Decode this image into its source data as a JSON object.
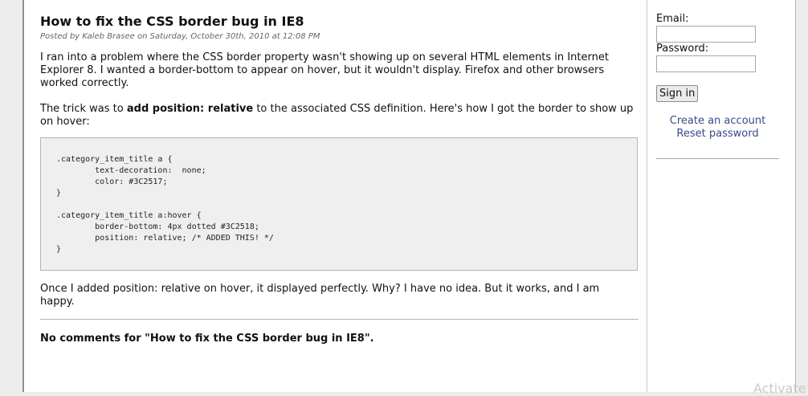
{
  "post": {
    "title": "How to fix the CSS border bug in IE8",
    "meta": "Posted by Kaleb Brasee on Saturday, October 30th, 2010 at 12:08 PM",
    "para1": "I ran into a problem where the CSS border property wasn't showing up on several HTML elements in Internet Explorer 8. I wanted a border-bottom to appear on hover, but it wouldn't display. Firefox and other browsers worked correctly.",
    "para2_before": "The trick was to ",
    "para2_bold": "add position: relative",
    "para2_after": " to the associated CSS definition. Here's how I got the border to show up on hover:",
    "code": ".category_item_title a {\n        text-decoration:  none;\n        color: #3C2517;\n}\n\n.category_item_title a:hover {\n        border-bottom: 4px dotted #3C2518;\n        position: relative; /* ADDED THIS! */\n}",
    "para3": "Once I added position: relative on hover, it displayed perfectly. Why? I have no idea. But it works, and I am happy.",
    "comments": "No comments for \"How to fix the CSS border bug in IE8\"."
  },
  "login": {
    "email_label": "Email:",
    "password_label": "Password:",
    "email_value": "",
    "password_value": "",
    "sign_in_label": "Sign in",
    "create_account_label": "Create an account",
    "reset_password_label": "Reset password"
  },
  "overlay": {
    "watermark_text": "Activate"
  },
  "colors": {
    "link": "#3a4a87",
    "code_background": "#efefef",
    "meta_text": "#666666"
  }
}
